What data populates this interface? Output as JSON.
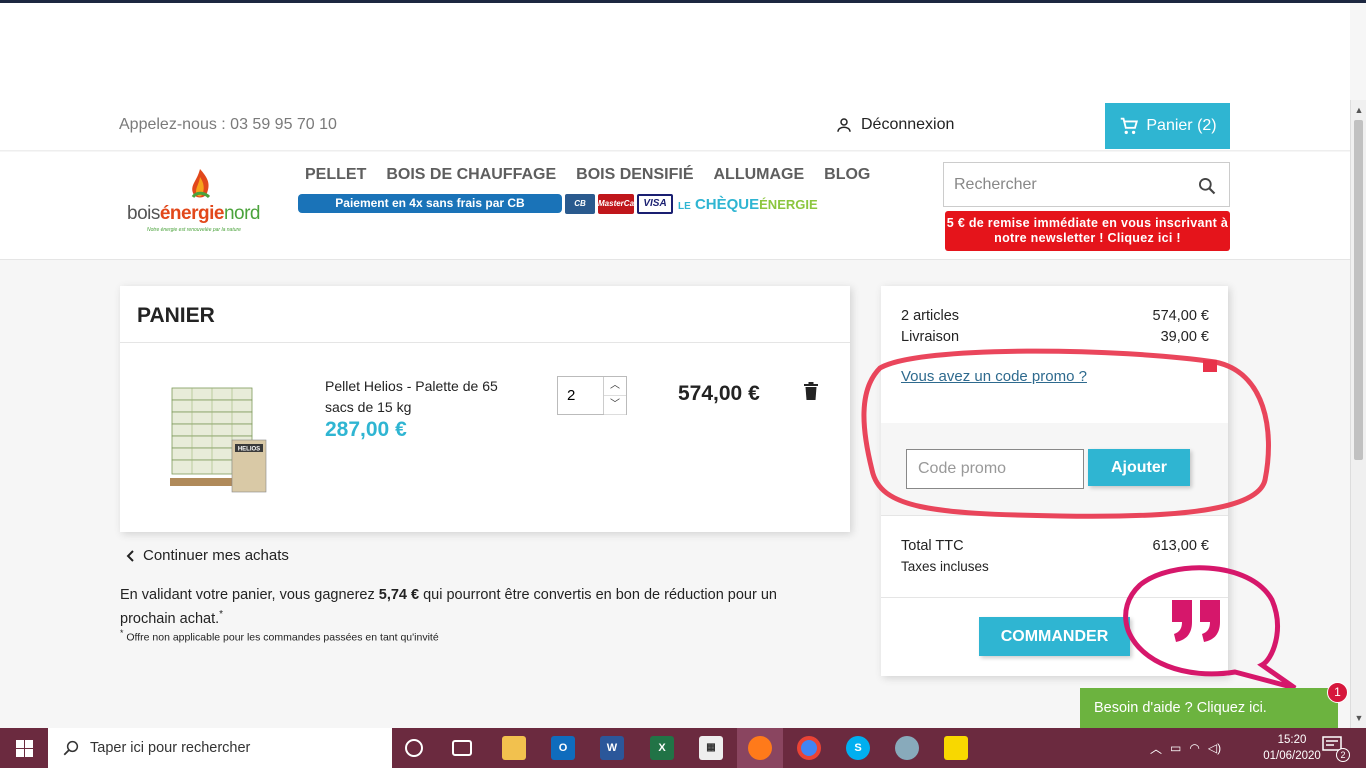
{
  "header": {
    "phone": "Appelez-nous : 03 59 95 70 10",
    "logout": "Déconnexion",
    "cart": "Panier (2)",
    "logo_text_a": "bois",
    "logo_text_b": "énergie",
    "logo_text_c": "nord",
    "logo_tagline": "Notre énergie est renouvelée par la nature",
    "menu": [
      "PELLET",
      "BOIS DE CHAUFFAGE",
      "BOIS DENSIFIÉ",
      "ALLUMAGE",
      "BLOG"
    ],
    "payment_banner": "Paiement en 4x sans frais par CB",
    "cards": [
      "CB",
      "MasterCard",
      "VISA"
    ],
    "cheque_le": "LE",
    "cheque_cheque": "CHÈQUE",
    "cheque_energie": "ÉNERGIE",
    "search_placeholder": "Rechercher",
    "newsletter": "5 € de remise immédiate en vous inscrivant à notre newsletter ! Cliquez ici !"
  },
  "cart": {
    "title": "PANIER",
    "item": {
      "name": "Pellet Helios - Palette de 65 sacs de 15 kg",
      "unit_price": "287,00 €",
      "quantity": "2",
      "line_total": "574,00 €",
      "bag_label": "HELIOS"
    },
    "continue": "Continuer mes achats",
    "loyalty_pre": "En validant votre panier, vous gagnerez ",
    "loyalty_amount": "5,74 €",
    "loyalty_post": " qui pourront être convertis en bon de réduction pour un prochain achat.",
    "loyalty_mark": "*",
    "footnote_mark": "*",
    "footnote": " Offre non applicable pour les commandes passées en tant qu'invité"
  },
  "summary": {
    "articles_label": "2 articles",
    "articles_value": "574,00 €",
    "shipping_label": "Livraison",
    "shipping_value": "39,00 €",
    "promo_link": "Vous avez un code promo ?",
    "promo_placeholder": "Code promo",
    "promo_button": "Ajouter",
    "total_label": "Total TTC",
    "total_value": "613,00 €",
    "taxes_label": "Taxes incluses",
    "taxes_value": "",
    "order_button": "COMMANDER"
  },
  "help": {
    "label": "Besoin d'aide ? Cliquez ici.",
    "badge": "1"
  },
  "taskbar": {
    "search_placeholder": "Taper ici pour rechercher",
    "time": "15:20",
    "date": "01/06/2020",
    "notifications": "2"
  },
  "colors": {
    "accent": "#2fb5d2",
    "annotation": "#e8324a",
    "help": "#6cb33f",
    "taskbar": "#6b2a3f"
  }
}
